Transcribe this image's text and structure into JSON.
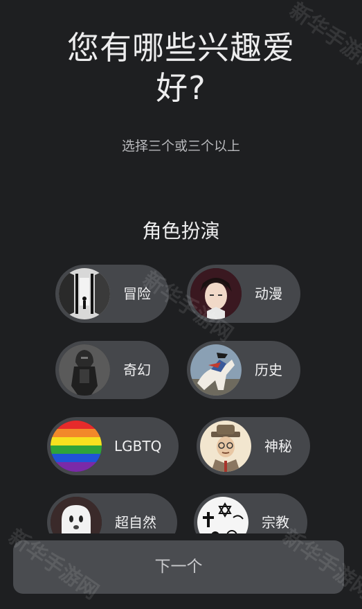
{
  "header": {
    "title_line1": "您有哪些兴趣爱",
    "title_line2": "好?",
    "subtitle": "选择三个或三个以上"
  },
  "section_title": "角色扮演",
  "chips": [
    {
      "label": "冒险",
      "icon": "adventure-corridor-figure"
    },
    {
      "label": "动漫",
      "icon": "anime-character"
    },
    {
      "label": "奇幻",
      "icon": "armored-knight"
    },
    {
      "label": "历史",
      "icon": "napoleon-horse"
    },
    {
      "label": "LGBTQ",
      "icon": "rainbow-flag"
    },
    {
      "label": "神秘",
      "icon": "detective-man"
    },
    {
      "label": "超自然",
      "icon": "ghost"
    },
    {
      "label": "宗教",
      "icon": "religious-symbols"
    }
  ],
  "next_button": "下一个",
  "watermark": "新华手游网",
  "colors": {
    "background": "#1e1f21",
    "chip": "#45474b",
    "button": "#4a4c50"
  }
}
